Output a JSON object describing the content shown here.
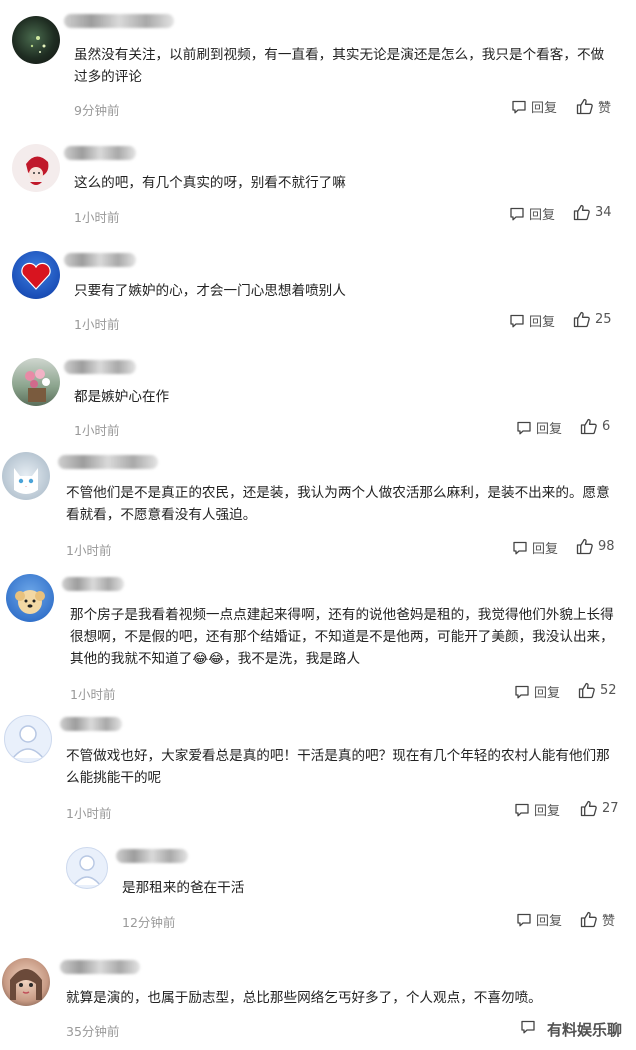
{
  "reply_label": "回复",
  "watermark": "有料娱乐聊",
  "comments": [
    {
      "text": "虽然没有关注，以前刷到视频，有一直看，其实无论是演还是怎么，我只是个看客，不做过多的评论",
      "time": "9分钟前",
      "likes": "赞",
      "avatar": "avatar-dark-green"
    },
    {
      "text": "这么的吧，有几个真实的呀，别看不就行了嘛",
      "time": "1小时前",
      "likes": "34",
      "avatar": "avatar-red-doll"
    },
    {
      "text": "只要有了嫉妒的心，才会一门心思想着喷别人",
      "time": "1小时前",
      "likes": "25",
      "avatar": "avatar-red-heart"
    },
    {
      "text": "都是嫉妒心在作",
      "time": "1小时前",
      "likes": "6",
      "avatar": "avatar-flowers"
    },
    {
      "text": "不管他们是不是真正的农民，还是装，我认为两个人做农活那么麻利，是装不出来的。愿意看就看，不愿意看没有人强迫。",
      "time": "1小时前",
      "likes": "98",
      "avatar": "avatar-white-cat"
    },
    {
      "text": "那个房子是我看着视频一点点建起来得啊，还有的说他爸妈是租的，我觉得他们外貌上长得很想啊，不是假的吧，还有那个结婚证，不知道是不是他两，可能开了美颜，我没认出来，其他的我就不知道了😂😂，我不是洗，我是路人",
      "time": "1小时前",
      "likes": "52",
      "avatar": "avatar-dog"
    },
    {
      "text": "不管做戏也好，大家爱看总是真的吧！干活是真的吧？现在有几个年轻的农村人能有他们那么能挑能干的呢",
      "time": "1小时前",
      "likes": "27",
      "avatar": "avatar-default"
    },
    {
      "text": "是那租来的爸在干活",
      "time": "12分钟前",
      "likes": "赞",
      "avatar": "avatar-default"
    },
    {
      "text": "就算是演的，也属于励志型，总比那些网络乞丐好多了，个人观点，不喜勿喷。",
      "time": "35分钟前",
      "likes": "",
      "avatar": "avatar-girl"
    }
  ]
}
